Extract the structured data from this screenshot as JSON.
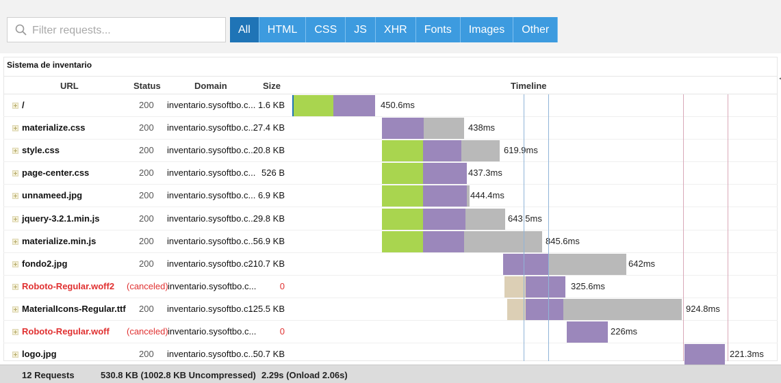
{
  "toolbar": {
    "search_placeholder": "Filter requests...",
    "filters": [
      {
        "label": "All",
        "active": true
      },
      {
        "label": "HTML",
        "active": false
      },
      {
        "label": "CSS",
        "active": false
      },
      {
        "label": "JS",
        "active": false
      },
      {
        "label": "XHR",
        "active": false
      },
      {
        "label": "Fonts",
        "active": false
      },
      {
        "label": "Images",
        "active": false
      },
      {
        "label": "Other",
        "active": false
      }
    ]
  },
  "page": {
    "title": "Sistema de inventario"
  },
  "columns": {
    "url": "URL",
    "status": "Status",
    "domain": "Domain",
    "size": "Size",
    "timeline": "Timeline"
  },
  "colors": {
    "wait": "#a9d54f",
    "receive": "#9b87bb",
    "blocked": "#b9b9b9",
    "dns": "#dccfb5",
    "accent": "#1f74b6",
    "error": "#e03030"
  },
  "requests": [
    {
      "url": "/",
      "status": "200",
      "domain": "inventario.sysoftbo.c...",
      "size": "1.6 KB",
      "time": "450.6ms",
      "error": false
    },
    {
      "url": "materialize.css",
      "status": "200",
      "domain": "inventario.sysoftbo.c...",
      "size": "27.4 KB",
      "time": "438ms",
      "error": false
    },
    {
      "url": "style.css",
      "status": "200",
      "domain": "inventario.sysoftbo.c...",
      "size": "20.8 KB",
      "time": "619.9ms",
      "error": false
    },
    {
      "url": "page-center.css",
      "status": "200",
      "domain": "inventario.sysoftbo.c...",
      "size": "526 B",
      "time": "437.3ms",
      "error": false
    },
    {
      "url": "unnameed.jpg",
      "status": "200",
      "domain": "inventario.sysoftbo.c...",
      "size": "6.9 KB",
      "time": "444.4ms",
      "error": false
    },
    {
      "url": "jquery-3.2.1.min.js",
      "status": "200",
      "domain": "inventario.sysoftbo.c...",
      "size": "29.8 KB",
      "time": "643.5ms",
      "error": false
    },
    {
      "url": "materialize.min.js",
      "status": "200",
      "domain": "inventario.sysoftbo.c...",
      "size": "56.9 KB",
      "time": "845.6ms",
      "error": false
    },
    {
      "url": "fondo2.jpg",
      "status": "200",
      "domain": "inventario.sysoftbo.c...",
      "size": "210.7 KB",
      "time": "642ms",
      "error": false
    },
    {
      "url": "Roboto-Regular.woff2",
      "status": "(canceled)",
      "domain": "inventario.sysoftbo.c...",
      "size": "0",
      "time": "325.6ms",
      "error": true
    },
    {
      "url": "MaterialIcons-Regular.ttf",
      "status": "200",
      "domain": "inventario.sysoftbo.c...",
      "size": "125.5 KB",
      "time": "924.8ms",
      "error": false
    },
    {
      "url": "Roboto-Regular.woff",
      "status": "(canceled)",
      "domain": "inventario.sysoftbo.c...",
      "size": "0",
      "time": "226ms",
      "error": true
    },
    {
      "url": "logo.jpg",
      "status": "200",
      "domain": "inventario.sysoftbo.c...",
      "size": "50.7 KB",
      "time": "221.3ms",
      "error": false
    }
  ],
  "footer": {
    "requests": "12 Requests",
    "size": "530.8 KB  (1002.8 KB Uncompressed)",
    "time": "2.29s  (Onload 2.06s)"
  }
}
